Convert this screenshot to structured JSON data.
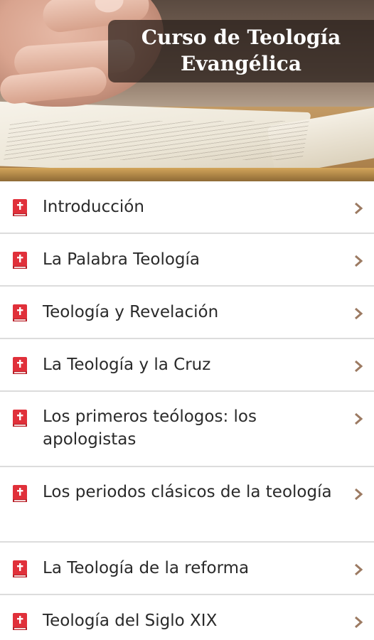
{
  "header": {
    "title_line1": "Curso de Teología",
    "title_line2": "Evangélica"
  },
  "icons": {
    "item": "book-icon",
    "chevron": "chevron-right-icon"
  },
  "colors": {
    "icon_red": "#e0303a",
    "chevron_brown": "#9c7a62",
    "divider": "#dcdcdc"
  },
  "items": [
    {
      "label": "Introducción"
    },
    {
      "label": "La Palabra Teología"
    },
    {
      "label": "Teología y Revelación"
    },
    {
      "label": "La Teología y la Cruz"
    },
    {
      "label": "Los primeros teólogos: los apologistas"
    },
    {
      "label": "Los periodos clásicos de la teología"
    },
    {
      "label": "La Teología de la reforma"
    },
    {
      "label": "Teología del Siglo XIX"
    }
  ]
}
